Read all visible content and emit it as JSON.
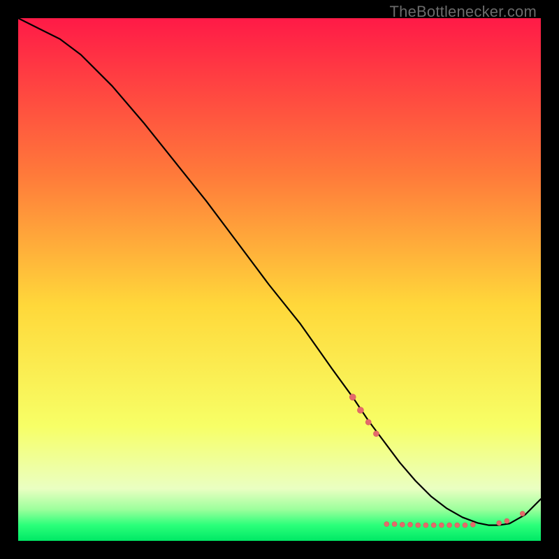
{
  "watermark": "TheBottlenecker.com",
  "colors": {
    "background": "#000000",
    "line": "#000000",
    "marker_fill": "#e46a6b",
    "marker_stroke": "#d55a5b",
    "grad_top": "#ff1a47",
    "grad_mid_upper": "#ff7a3a",
    "grad_mid": "#ffd83a",
    "grad_mid_lower": "#f7ff66",
    "grad_low": "#eaffc2",
    "grad_green1": "#9cff9c",
    "grad_green2": "#2bff7a",
    "grad_green3": "#00e865"
  },
  "chart_data": {
    "type": "line",
    "title": "",
    "xlabel": "",
    "ylabel": "",
    "xlim": [
      0,
      100
    ],
    "ylim": [
      0,
      100
    ],
    "series": [
      {
        "name": "curve",
        "x": [
          0,
          4,
          8,
          12,
          18,
          24,
          30,
          36,
          42,
          48,
          54,
          60,
          64,
          67,
          70,
          73,
          76,
          79,
          82,
          85,
          88,
          90,
          92,
          94,
          97,
          100
        ],
        "y": [
          100,
          98,
          96,
          93,
          87,
          80,
          72.5,
          65,
          57,
          49,
          41.5,
          33,
          27.5,
          23,
          19,
          15,
          11.5,
          8.5,
          6.2,
          4.5,
          3.4,
          3.0,
          3.0,
          3.3,
          5.0,
          8.0
        ]
      }
    ],
    "markers": [
      {
        "x": 64.0,
        "y": 27.5,
        "r": 4.5
      },
      {
        "x": 65.5,
        "y": 25.0,
        "r": 4.5
      },
      {
        "x": 67.0,
        "y": 22.7,
        "r": 4.0
      },
      {
        "x": 68.5,
        "y": 20.5,
        "r": 4.0
      },
      {
        "x": 70.5,
        "y": 3.2,
        "r": 3.5
      },
      {
        "x": 72.0,
        "y": 3.2,
        "r": 3.5
      },
      {
        "x": 73.5,
        "y": 3.1,
        "r": 3.5
      },
      {
        "x": 75.0,
        "y": 3.1,
        "r": 3.5
      },
      {
        "x": 76.5,
        "y": 3.0,
        "r": 3.5
      },
      {
        "x": 78.0,
        "y": 3.0,
        "r": 3.5
      },
      {
        "x": 79.5,
        "y": 3.0,
        "r": 3.5
      },
      {
        "x": 81.0,
        "y": 3.0,
        "r": 3.5
      },
      {
        "x": 82.5,
        "y": 3.0,
        "r": 3.5
      },
      {
        "x": 84.0,
        "y": 3.0,
        "r": 3.5
      },
      {
        "x": 85.5,
        "y": 3.0,
        "r": 3.5
      },
      {
        "x": 87.0,
        "y": 3.1,
        "r": 3.5
      },
      {
        "x": 92.0,
        "y": 3.4,
        "r": 3.5
      },
      {
        "x": 93.5,
        "y": 3.8,
        "r": 3.5
      },
      {
        "x": 96.5,
        "y": 5.2,
        "r": 3.5
      }
    ],
    "gradient_stops": [
      {
        "offset": 0.0,
        "key": "grad_top"
      },
      {
        "offset": 0.3,
        "key": "grad_mid_upper"
      },
      {
        "offset": 0.55,
        "key": "grad_mid"
      },
      {
        "offset": 0.78,
        "key": "grad_mid_lower"
      },
      {
        "offset": 0.9,
        "key": "grad_low"
      },
      {
        "offset": 0.94,
        "key": "grad_green1"
      },
      {
        "offset": 0.97,
        "key": "grad_green2"
      },
      {
        "offset": 1.0,
        "key": "grad_green3"
      }
    ]
  }
}
